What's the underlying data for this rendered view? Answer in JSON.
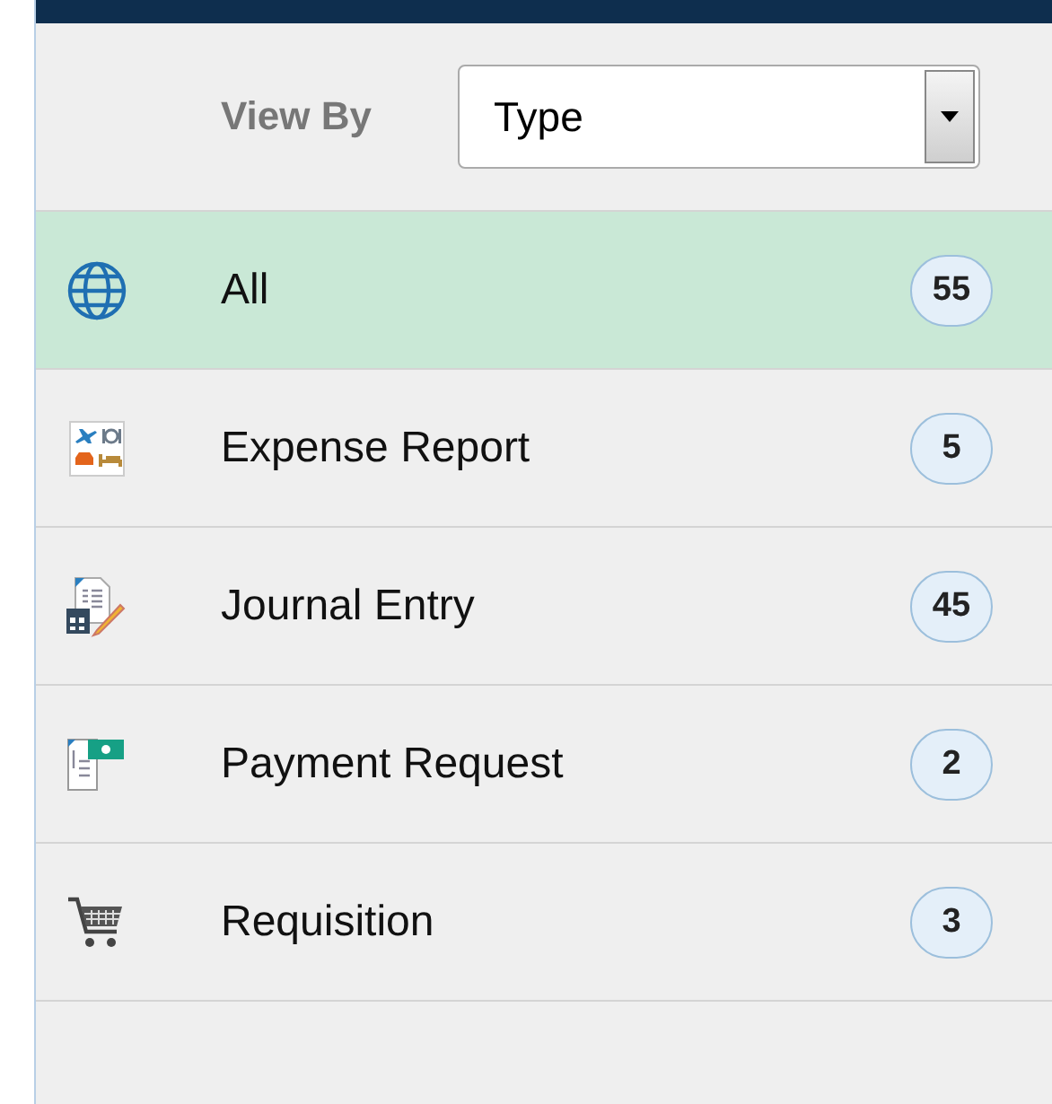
{
  "filter": {
    "label": "View By",
    "value": "Type"
  },
  "items": [
    {
      "label": "All",
      "count": "55",
      "selected": true
    },
    {
      "label": "Expense Report",
      "count": "5",
      "selected": false
    },
    {
      "label": "Journal Entry",
      "count": "45",
      "selected": false
    },
    {
      "label": "Payment Request",
      "count": "2",
      "selected": false
    },
    {
      "label": "Requisition",
      "count": "3",
      "selected": false
    }
  ]
}
